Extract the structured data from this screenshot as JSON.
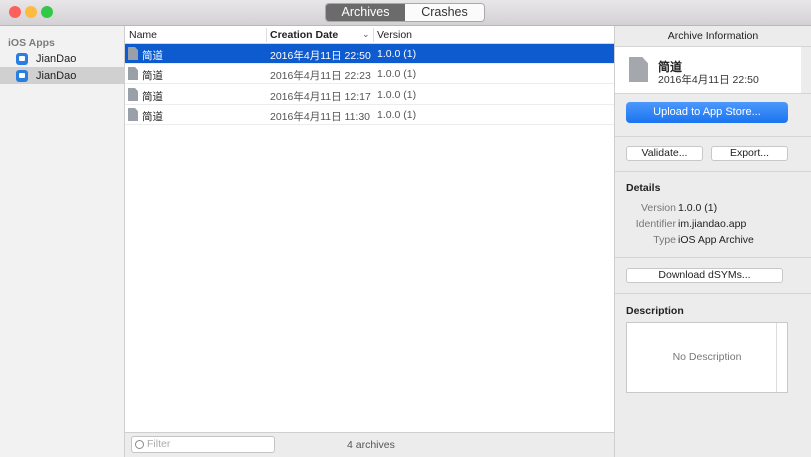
{
  "window": {
    "tabs": [
      "Archives",
      "Crashes"
    ],
    "active_tab": "Archives",
    "traffic_lights": {
      "close": "#fc605c",
      "minimize": "#fdbc40",
      "zoom": "#34c84a"
    }
  },
  "sidebar": {
    "section": "iOS Apps",
    "items": [
      {
        "label": "JianDao",
        "selected": false
      },
      {
        "label": "JianDao",
        "selected": true
      }
    ]
  },
  "table": {
    "columns": [
      "Name",
      "Creation Date",
      "Version"
    ],
    "sort_icon": "chevron-down-icon",
    "rows": [
      {
        "name": "简道",
        "date": "2016年4月11日 22:50",
        "version": "1.0.0 (1)",
        "selected": true
      },
      {
        "name": "简道",
        "date": "2016年4月11日 22:23",
        "version": "1.0.0 (1)",
        "selected": false
      },
      {
        "name": "简道",
        "date": "2016年4月11日 12:17",
        "version": "1.0.0 (1)",
        "selected": false
      },
      {
        "name": "简道",
        "date": "2016年4月11日 11:30",
        "version": "1.0.0 (1)",
        "selected": false
      }
    ],
    "filter_placeholder": "Filter",
    "count": "4 archives"
  },
  "inspector": {
    "title": "Archive Information",
    "archive_name": "简道",
    "archive_date": "2016年4月11日 22:50",
    "upload_label": "Upload to App Store...",
    "validate_label": "Validate...",
    "export_label": "Export...",
    "details_heading": "Details",
    "details": [
      {
        "key": "Version",
        "value": "1.0.0 (1)"
      },
      {
        "key": "Identifier",
        "value": "im.jiandao.app"
      },
      {
        "key": "Type",
        "value": "iOS App Archive"
      }
    ],
    "dsyms_label": "Download dSYMs...",
    "description_heading": "Description",
    "description_placeholder": "No Description"
  }
}
